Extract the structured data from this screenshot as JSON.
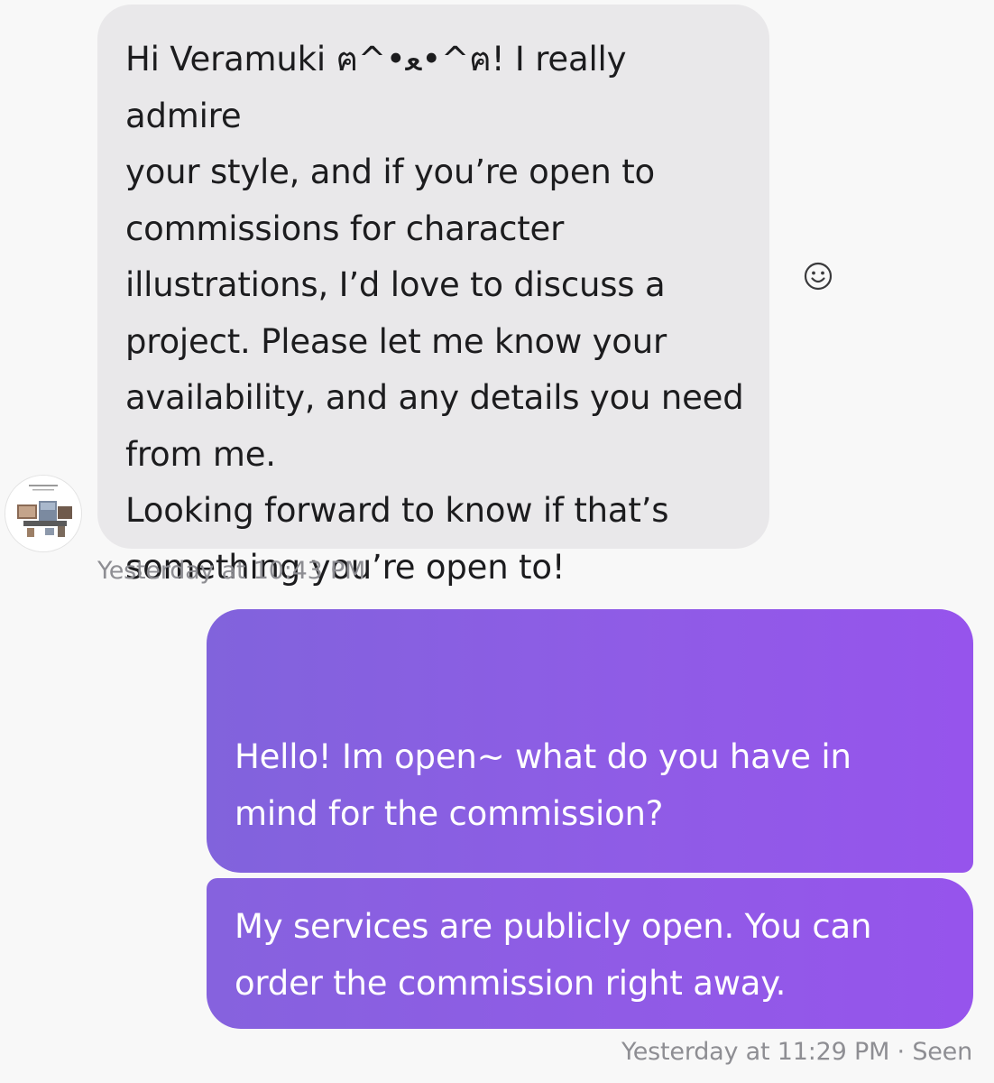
{
  "conversation": {
    "incoming_message": {
      "lines": [
        "Hi Veramuki ฅ^•ﻌ•^ฅ! I really admire",
        "your style, and if you’re open to",
        "commissions for character",
        "illustrations, I’d love to discuss a",
        "project. Please let me know your",
        "availability, and any details you need",
        "from me.",
        "Looking forward to know if that’s",
        "something you’re open to!"
      ],
      "timestamp": "Yesterday at 10:43 PM"
    },
    "reaction_icon": "smiley-face-icon",
    "outgoing_messages": [
      {
        "lines": [
          "Hello! Im open~ what do you have in",
          "mind for the commission?"
        ]
      },
      {
        "lines": [
          "My services are publicly open. You can",
          "order the commission right away."
        ]
      }
    ],
    "outgoing_status": "Yesterday at 11:29 PM · Seen"
  },
  "colors": {
    "background": "#f8f8f8",
    "incoming_bubble": "#e9e8ea",
    "outgoing_bubble_start": "#8163dc",
    "outgoing_bubble_end": "#9654ec",
    "timestamp_text": "#8e8e93"
  }
}
